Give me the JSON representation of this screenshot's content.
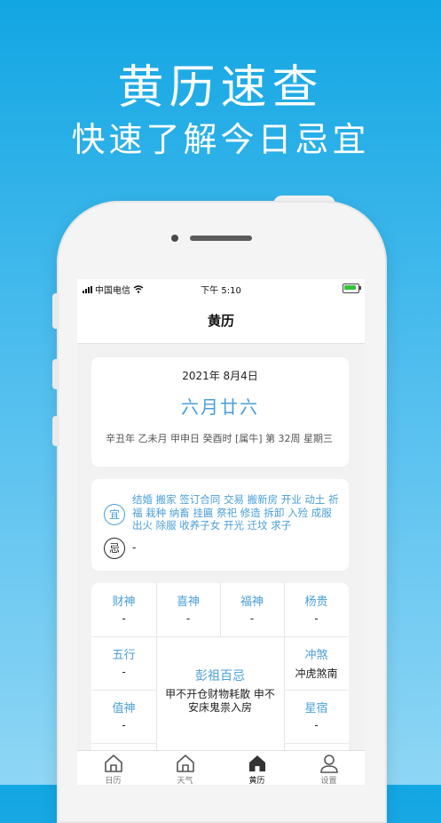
{
  "promo": {
    "title": "黄历速查",
    "subtitle": "快速了解今日忌宜"
  },
  "statusbar": {
    "carrier": "中国电信",
    "time": "下午 5:10"
  },
  "navbar": {
    "title": "黄历"
  },
  "date": {
    "solar": "2021年 8月4日",
    "lunar": "六月廿六",
    "ganzhi": "辛丑年 乙未月 甲申日 癸酉时 [属牛] 第 32周 星期三"
  },
  "yiji": {
    "yi_label": "宜",
    "yi_items": "结婚 搬家 签订合同 交易 搬新房 开业 动土 祈福 栽种 纳畜 挂匾 祭祀 修造 拆卸 入殓 成服 出火 除服 收养子女 开光 迁坟 求子",
    "ji_label": "忌",
    "ji_items": "-"
  },
  "gods": {
    "caishen": {
      "title": "财神",
      "value": "-"
    },
    "xishen": {
      "title": "喜神",
      "value": "-"
    },
    "fushen": {
      "title": "福神",
      "value": "-"
    },
    "yanggui": {
      "title": "杨贵",
      "value": "-"
    },
    "wuxing": {
      "title": "五行",
      "value": "-"
    },
    "pengzu": {
      "title": "彭祖百忌",
      "value": "甲不开仓财物耗散 申不安床鬼祟入房"
    },
    "chongsha": {
      "title": "冲煞",
      "value": "冲虎煞南"
    },
    "zhishen": {
      "title": "值神",
      "value": "-"
    },
    "xingxiu": {
      "title": "星宿",
      "value": "-"
    }
  },
  "tabs": [
    {
      "label": "日历",
      "icon": "home-icon"
    },
    {
      "label": "天气",
      "icon": "home-icon"
    },
    {
      "label": "黄历",
      "icon": "home-filled-icon"
    },
    {
      "label": "设置",
      "icon": "user-icon"
    }
  ],
  "colors": {
    "accent": "#4a9fd8",
    "background_top": "#12a6e3",
    "battery": "#35c23a"
  }
}
